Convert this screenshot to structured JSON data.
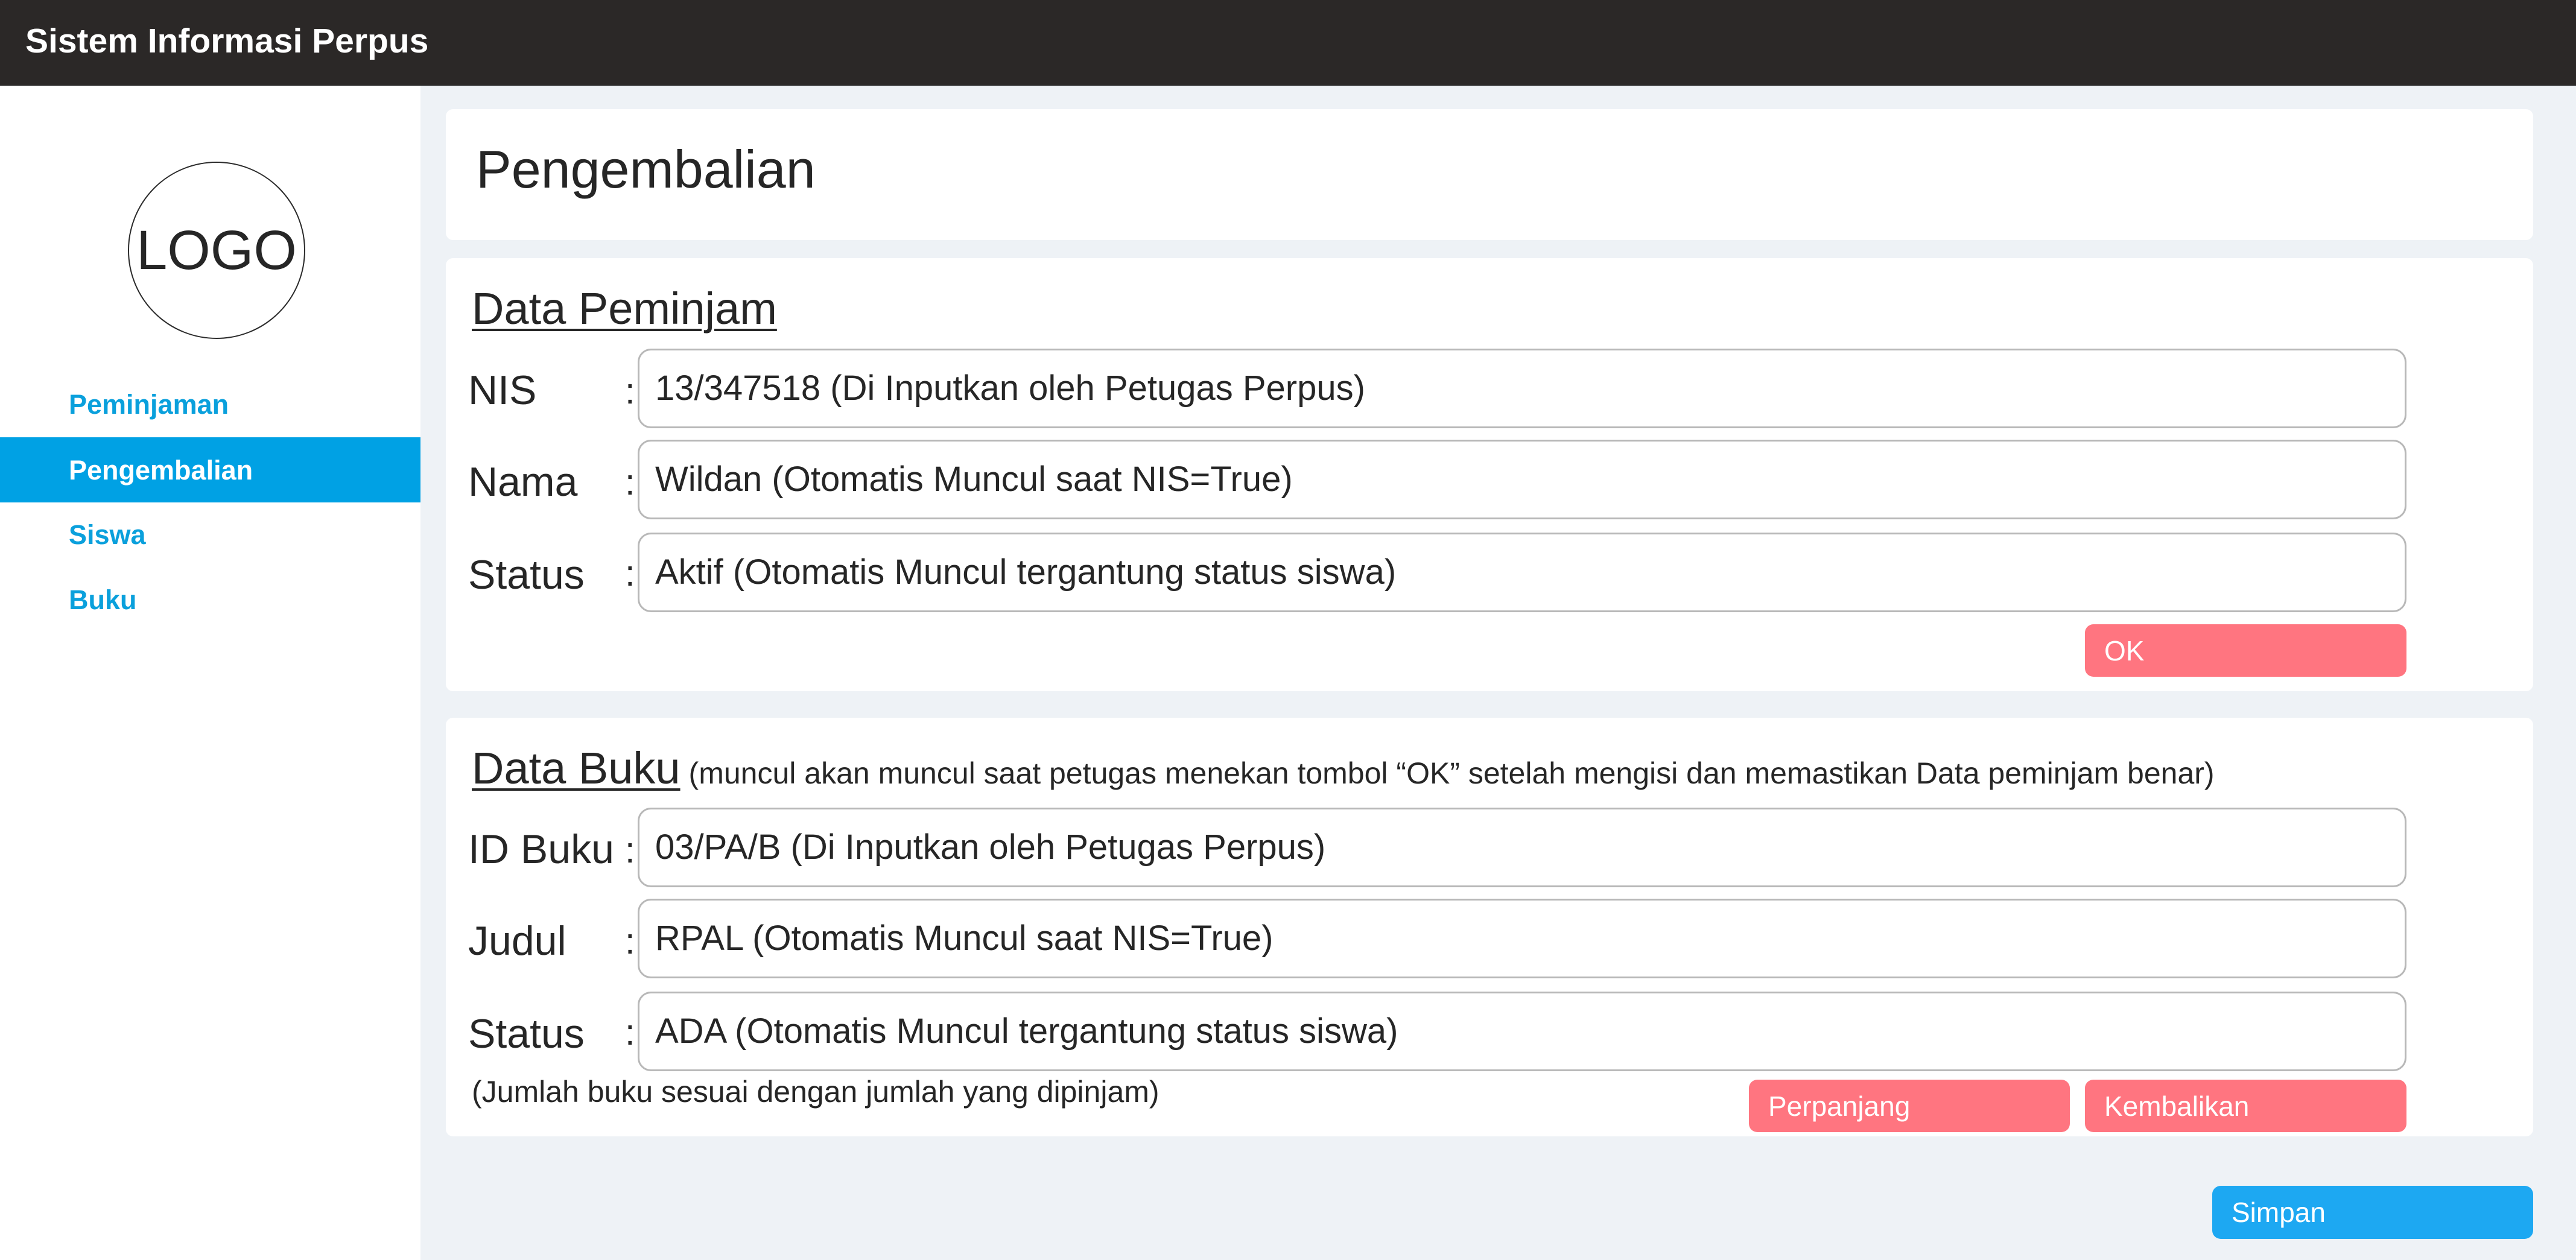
{
  "app": {
    "title": "Sistem Informasi Perpus"
  },
  "sidebar": {
    "logo_text": "LOGO",
    "items": [
      {
        "label": "Peminjaman",
        "active": false
      },
      {
        "label": "Pengembalian",
        "active": true
      },
      {
        "label": "Siswa",
        "active": false
      },
      {
        "label": "Buku",
        "active": false
      }
    ]
  },
  "page": {
    "title": "Pengembalian"
  },
  "peminjam": {
    "title": "Data Peminjam",
    "colon": ":",
    "fields": [
      {
        "label": "NIS",
        "value": "13/347518 (Di Inputkan oleh Petugas Perpus)"
      },
      {
        "label": "Nama",
        "value": "Wildan (Otomatis Muncul saat NIS=True)"
      },
      {
        "label": "Status",
        "value": "Aktif (Otomatis Muncul tergantung status siswa)"
      }
    ],
    "ok_label": "OK"
  },
  "buku": {
    "title": "Data Buku",
    "note": "(muncul akan muncul saat petugas menekan tombol “OK” setelah mengisi dan memastikan Data peminjam benar)",
    "colon": ":",
    "fields": [
      {
        "label": "ID Buku",
        "value": "03/PA/B (Di Inputkan oleh Petugas Perpus)"
      },
      {
        "label": "Judul",
        "value": "RPAL (Otomatis Muncul saat NIS=True)"
      },
      {
        "label": "Status",
        "value": "ADA (Otomatis Muncul tergantung status siswa)"
      }
    ],
    "footnote": "(Jumlah buku sesuai dengan jumlah yang dipinjam)",
    "perpanjang_label": "Perpanjang",
    "kembalikan_label": "Kembalikan"
  },
  "footer": {
    "simpan_label": "Simpan"
  },
  "colors": {
    "topbar": "#2b2827",
    "accent_blue": "#00a1e4",
    "button_red": "#ff7580",
    "button_blue": "#1da8f2",
    "content_bg": "#eef2f6"
  }
}
